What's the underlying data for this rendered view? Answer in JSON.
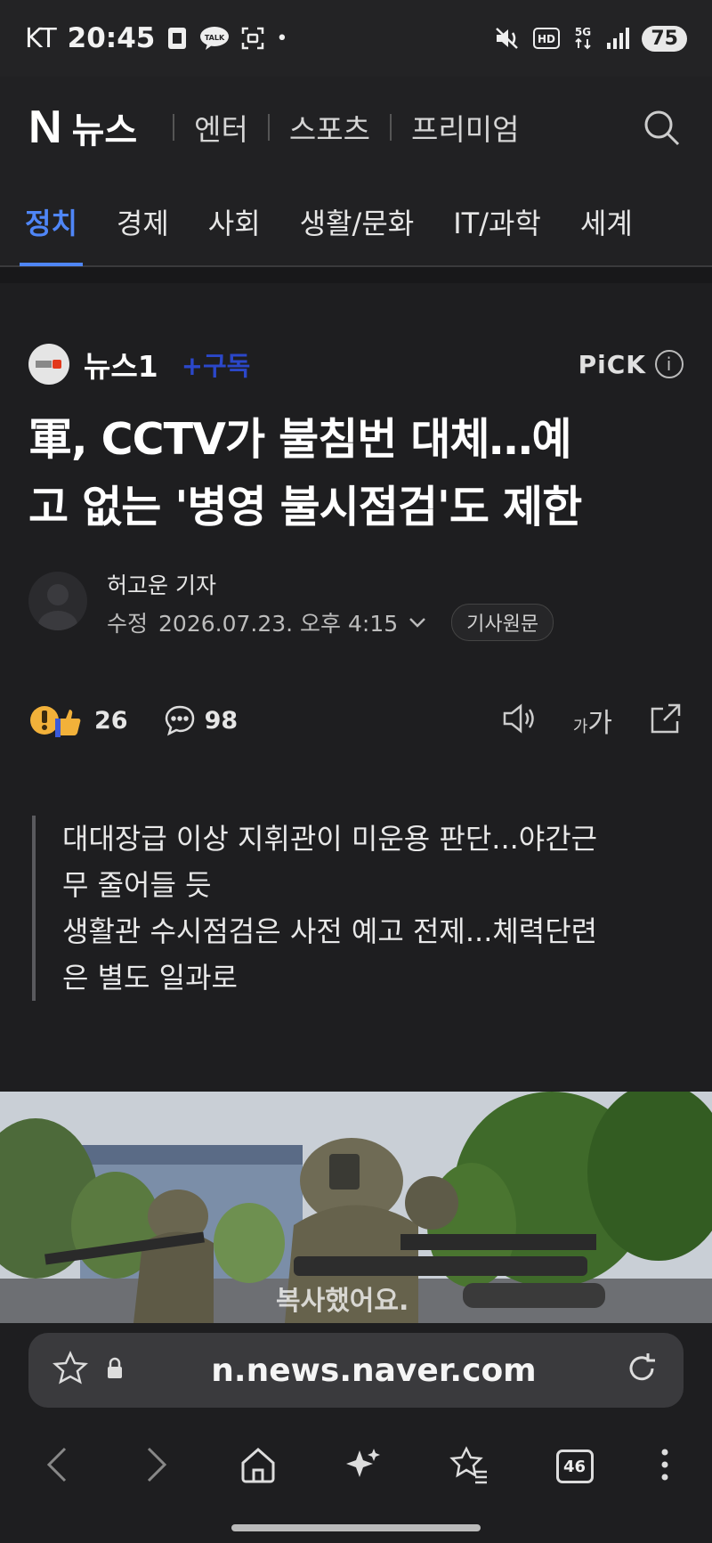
{
  "status_bar": {
    "carrier": "KT",
    "time": "20:45",
    "talk_label": "TALK",
    "battery": "75"
  },
  "header": {
    "logo_n": "N",
    "logo_news": "뉴스",
    "nav": [
      "엔터",
      "스포츠",
      "프리미엄"
    ]
  },
  "categories": [
    "정치",
    "경제",
    "사회",
    "생활/문화",
    "IT/과학",
    "세계"
  ],
  "article": {
    "press_name": "뉴스1",
    "subscribe_label": "+구독",
    "pick_label": "PiCK",
    "headline_line1": "軍, CCTV가 불침번 대체…예",
    "headline_line2": "고 없는 '병영 불시점검'도 제한",
    "reporter": "허고운 기자",
    "date_prefix": "수정",
    "date": "2026.07.23. 오후 4:15",
    "original_button": "기사원문",
    "reaction_count": "26",
    "comment_count": "98",
    "font_small": "가",
    "font_large": "가",
    "summary": [
      "대대장급 이상 지휘관이 미운용 판단...야간근",
      "무 줄어들 듯",
      "생활관 수시점검은 사전 예고 전제...체력단련",
      "은 별도 일과로"
    ],
    "toast": "복사했어요."
  },
  "browser": {
    "url": "n.news.naver.com",
    "tab_count": "46"
  }
}
